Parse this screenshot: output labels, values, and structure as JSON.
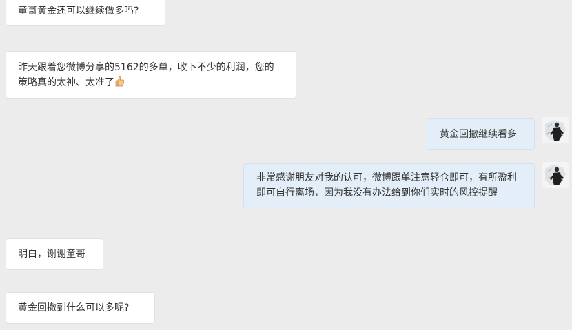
{
  "messages": [
    {
      "side": "left",
      "text": "童哥黄金还可以继续做多吗?"
    },
    {
      "side": "left",
      "text": "昨天跟着您微博分享的5162的多单，收下不少的利润，您的策略真的太神、太准了",
      "emoji": "thumbs-up-icon"
    },
    {
      "side": "right",
      "text": "黄金回撤继续看多"
    },
    {
      "side": "right",
      "text": "非常感谢朋友对我的认可，微博跟单注意轻仓即可，有所盈利即可自行离场，因为我没有办法给到你们实时的风控提醒"
    },
    {
      "side": "left",
      "text": "明白，谢谢童哥"
    },
    {
      "side": "left",
      "text": "黄金回撤到什么可以多呢?"
    }
  ],
  "colors": {
    "background": "#ececec",
    "left_bubble": "#ffffff",
    "right_bubble": "#e3eef8",
    "text": "#333333"
  }
}
